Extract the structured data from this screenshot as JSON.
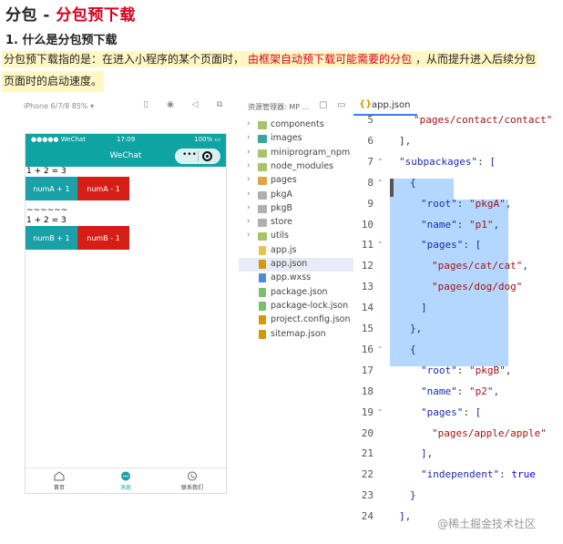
{
  "heading": {
    "prefix": "分包",
    "sep": " - ",
    "highlight": "分包预下载"
  },
  "subtitle": "1. 什么是分包预下载",
  "desc": {
    "part1": "分包预下载指的是：在进入小程序的某个页面时，",
    "red": "由框架自动预下载可能需要的分包",
    "part2": "，从而提升进入后续分包",
    "line2": "页面时的启动速度。"
  },
  "simulator": {
    "device": "iPhone 6/7/8 85% ▾",
    "status_left": "●●●●● WeChat",
    "status_time": "17:09",
    "status_right": "100% ▭",
    "nav_title": "WeChat",
    "capsule_dots": "•••",
    "row1_text": "1 + 2 = 3",
    "btn_a_plus": "numA + 1",
    "btn_a_minus": "numA - 1",
    "tilde": "~~~~~~",
    "row2_text": "1 + 2 = 3",
    "btn_b_plus": "numB + 1",
    "btn_b_minus": "numB - 1",
    "tabs": [
      {
        "label": "首页",
        "icon": "home-icon"
      },
      {
        "label": "消息",
        "icon": "message-icon"
      },
      {
        "label": "联系我们",
        "icon": "phone-icon"
      }
    ]
  },
  "tree": {
    "header": "资源管理器: MP ...",
    "items": [
      {
        "label": "components",
        "kind": "folder",
        "color": "#a9c26b",
        "chev": "›"
      },
      {
        "label": "images",
        "kind": "folder",
        "color": "#3aa6a0",
        "chev": "›"
      },
      {
        "label": "miniprogram_npm",
        "kind": "folder",
        "color": "#a9c26b",
        "chev": "›"
      },
      {
        "label": "node_modules",
        "kind": "folder",
        "color": "#a9c26b",
        "chev": "›"
      },
      {
        "label": "pages",
        "kind": "folder",
        "color": "#e2a44a",
        "chev": "›"
      },
      {
        "label": "pkgA",
        "kind": "folder",
        "color": "#b0b0b0",
        "chev": "›"
      },
      {
        "label": "pkgB",
        "kind": "folder",
        "color": "#b0b0b0",
        "chev": "›"
      },
      {
        "label": "store",
        "kind": "folder",
        "color": "#b0b0b0",
        "chev": "›"
      },
      {
        "label": "utils",
        "kind": "folder",
        "color": "#a9c26b",
        "chev": "›"
      },
      {
        "label": "app.js",
        "kind": "file",
        "color": "#e8c34a",
        "chev": ""
      },
      {
        "label": "app.json",
        "kind": "file",
        "color": "#d29a00",
        "chev": ""
      },
      {
        "label": "app.wxss",
        "kind": "file",
        "color": "#4c8dd6",
        "chev": ""
      },
      {
        "label": "package.json",
        "kind": "file",
        "color": "#7bbf6a",
        "chev": ""
      },
      {
        "label": "package-lock.json",
        "kind": "file",
        "color": "#7bbf6a",
        "chev": ""
      },
      {
        "label": "project.config.json",
        "kind": "file",
        "color": "#d29a00",
        "chev": ""
      },
      {
        "label": "sitemap.json",
        "kind": "file",
        "color": "#d29a00",
        "chev": ""
      }
    ],
    "selected": "app.json"
  },
  "editor": {
    "tab_icon": "{}",
    "tab_label": "app.json",
    "lines": [
      {
        "n": "5",
        "fold": "",
        "html": "<span class='s'>\"pages/contact/contact\"</span>"
      },
      {
        "n": "6",
        "fold": "",
        "html": "<span class='p'>],</span>"
      },
      {
        "n": "7",
        "fold": "⌄",
        "html": "<span class='k'>\"subpackages\"</span><span class='p'>: </span><span class='b'>[</span>"
      },
      {
        "n": "8",
        "fold": "⌄",
        "html": "<span class='b'>{</span>"
      },
      {
        "n": "9",
        "fold": "",
        "html": "<span class='k'>\"root\"</span><span class='p'>: </span><span class='s'>\"pkgA\"</span><span class='p'>,</span>"
      },
      {
        "n": "10",
        "fold": "",
        "html": "<span class='k'>\"name\"</span><span class='p'>: </span><span class='s'>\"p1\"</span><span class='p'>,</span>"
      },
      {
        "n": "11",
        "fold": "⌄",
        "html": "<span class='k'>\"pages\"</span><span class='p'>: </span><span class='b'>[</span>"
      },
      {
        "n": "12",
        "fold": "",
        "html": "<span class='s'>\"pages/cat/cat\"</span><span class='p'>,</span>"
      },
      {
        "n": "13",
        "fold": "",
        "html": "<span class='s'>\"pages/dog/dog\"</span>"
      },
      {
        "n": "14",
        "fold": "",
        "html": "<span class='b'>]</span>"
      },
      {
        "n": "15",
        "fold": "",
        "html": "<span class='b'>}</span><span class='p'>,</span>"
      },
      {
        "n": "16",
        "fold": "⌄",
        "html": "<span class='b'>{</span>"
      },
      {
        "n": "17",
        "fold": "",
        "html": "<span class='k'>\"root\"</span><span class='p'>: </span><span class='s'>\"pkgB\"</span><span class='p'>,</span>"
      },
      {
        "n": "18",
        "fold": "",
        "html": "<span class='k'>\"name\"</span><span class='p'>: </span><span class='s'>\"p2\"</span><span class='p'>,</span>"
      },
      {
        "n": "19",
        "fold": "⌄",
        "html": "<span class='k'>\"pages\"</span><span class='p'>: </span><span class='b'>[</span>"
      },
      {
        "n": "20",
        "fold": "",
        "html": "<span class='s'>\"pages/apple/apple\"</span>"
      },
      {
        "n": "21",
        "fold": "",
        "html": "<span class='b'>]</span><span class='p'>,</span>"
      },
      {
        "n": "22",
        "fold": "",
        "html": "<span class='k'>\"independent\"</span><span class='p'>: </span><span class='kw'>true</span>"
      },
      {
        "n": "23",
        "fold": "",
        "html": "<span class='b'>}</span>"
      },
      {
        "n": "24",
        "fold": "",
        "html": "<span class='b'>]</span><span class='p'>,</span>"
      }
    ]
  },
  "watermark": "@稀土掘金技术社区"
}
